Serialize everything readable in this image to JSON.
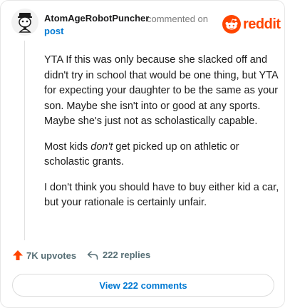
{
  "comment": {
    "author": "AtomAgeRobotPuncher",
    "action_text": "commented on",
    "post_link": "post",
    "paragraphs": {
      "p1": "YTA If this was only because she slacked off and didn't try in school that would be one thing, but YTA for expecting your daughter to be the same as your son. Maybe she isn't into or good at any sports. Maybe she's just not as scholastically capable.",
      "p2_pre": "Most kids ",
      "p2_em": "don't",
      "p2_post": " get picked up on athletic or scholastic grants.",
      "p3": "I don't think you should have to buy either kid a car, but your rationale is certainly unfair."
    },
    "upvotes": "7K upvotes",
    "replies": "222 replies",
    "view_button": "View 222 comments"
  },
  "branding": {
    "logo_text": "reddit",
    "brand_color": "#ff4500",
    "link_color": "#0079d3"
  },
  "icons": {
    "avatar": "robot-avatar",
    "logo": "reddit-snoo-icon",
    "upvote": "upvote-arrow-icon",
    "reply": "reply-arrow-icon"
  }
}
